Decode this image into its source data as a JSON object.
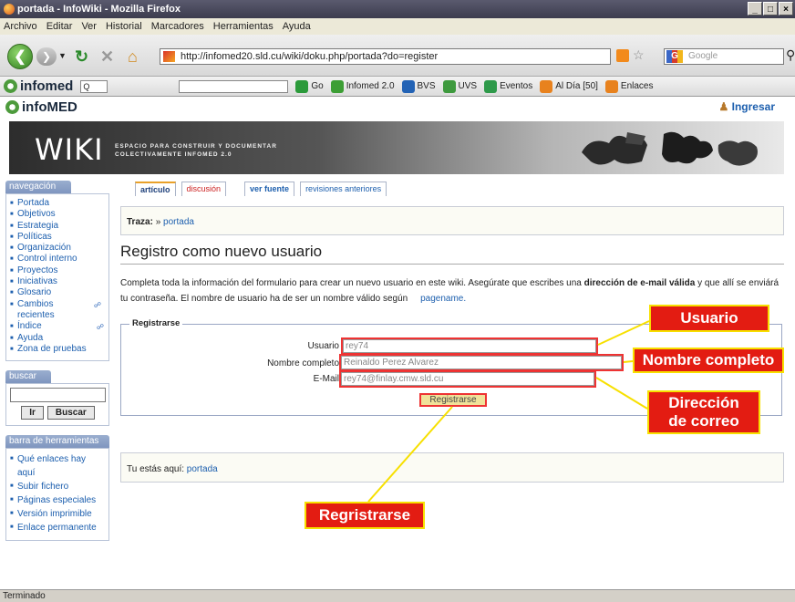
{
  "window": {
    "title": "portada - InfoWiki - Mozilla Firefox",
    "controls": [
      "_",
      "□",
      "×"
    ]
  },
  "menu": [
    "Archivo",
    "Editar",
    "Ver",
    "Historial",
    "Marcadores",
    "Herramientas",
    "Ayuda"
  ],
  "toolbar": {
    "url": "http://infomed20.sld.cu/wiki/doku.php/portada?do=register",
    "search_placeholder": "Google",
    "search_engine_letter": "G"
  },
  "bookmarks": {
    "logo": "infomed",
    "quick_search": "Q",
    "items": [
      {
        "label": "Go",
        "color": "#2b9a3a"
      },
      {
        "label": "Infomed 2.0",
        "color": "#3c9e34"
      },
      {
        "label": "BVS",
        "color": "#2363b5"
      },
      {
        "label": "UVS",
        "color": "#3e9a3e"
      },
      {
        "label": "Eventos",
        "color": "#2e9a4a"
      },
      {
        "label": "Al Día [50]",
        "color": "#e8821e"
      },
      {
        "label": "Enlaces",
        "color": "#e8821e"
      }
    ]
  },
  "site": {
    "logo": "infoMED",
    "login": "Ingresar",
    "banner_title": "WIKI",
    "banner_tag1": "ESPACIO PARA CONSTRUIR Y DOCUMENTAR",
    "banner_tag2": "COLECTIVAMENTE INFOMED 2.0"
  },
  "sidebar": {
    "nav_title": "navegación",
    "nav_items": [
      "Portada",
      "Objetivos",
      "Estrategia",
      "Políticas",
      "Organización",
      "Control interno",
      "Proyectos",
      "Iniciativas",
      "Glosario",
      "Cambios recientes",
      "Índice",
      "Ayuda",
      "Zona de pruebas"
    ],
    "search_title": "buscar",
    "search_btn_go": "Ir",
    "search_btn_search": "Buscar",
    "tools_title": "barra de herramientas",
    "tools_items": [
      "Qué enlaces hay aquí",
      "Subir fichero",
      "Páginas especiales",
      "Versión imprimible",
      "Enlace permanente"
    ]
  },
  "tabs": [
    "artículo",
    "discusión",
    "ver fuente",
    "revisiones anteriores"
  ],
  "trail": {
    "prefix": "Traza:",
    "sep": "»",
    "link": "portada"
  },
  "content": {
    "heading": "Registro como nuevo usuario",
    "intro_1": "Completa toda la información del formulario para crear un nuevo usuario en este wiki. Asegúrate que escribes una ",
    "intro_bold": "dirección de e-mail válida",
    "intro_2": " y que allí se enviárá tu contraseña. El nombre de usuario ha de ser un nombre válido según",
    "intro_link": "pagename."
  },
  "form": {
    "legend": "Registrarse",
    "username_label": "Usuario",
    "username_value": "rey74",
    "fullname_label": "Nombre completo",
    "fullname_value": "Reinaldo Perez Alvarez",
    "email_label": "E-Mail",
    "email_value": "rey74@finlay.cmw.sld.cu",
    "submit": "Registrarse"
  },
  "footer": {
    "prefix": "Tu estás aquí:",
    "link": "portada"
  },
  "callouts": {
    "usuario": "Usuario",
    "nombre": "Nombre completo",
    "correo_1": "Dirección",
    "correo_2": "de correo",
    "registrarse": "Regristrarse"
  },
  "status": "Terminado",
  "colors": {
    "callout_fill": "#e31c12",
    "callout_border": "#f7e000",
    "link": "#1d5fae"
  }
}
